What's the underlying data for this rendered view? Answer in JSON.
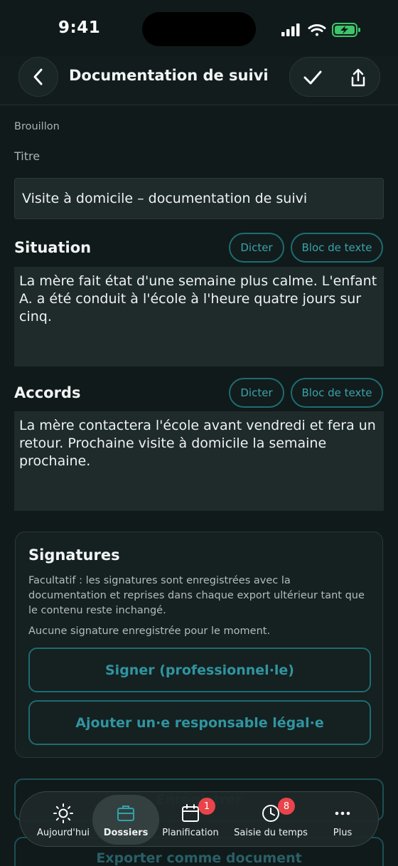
{
  "status_bar": {
    "time": "9:41"
  },
  "header": {
    "title": "Documentation de suivi"
  },
  "form": {
    "status": "Brouillon",
    "title_label": "Titre",
    "title_value": "Visite à domicile – documentation de suivi",
    "situation": {
      "heading": "Situation",
      "dictate_label": "Dicter",
      "text_block_label": "Bloc de texte",
      "text": "La mère fait état d'une semaine plus calme. L'enfant A. a été conduit à l'école à l'heure quatre jours sur cinq."
    },
    "agreements": {
      "heading": "Accords",
      "dictate_label": "Dicter",
      "text_block_label": "Bloc de texte",
      "text": "La mère contactera l'école avant vendredi et fera un retour. Prochaine visite à domicile la semaine prochaine."
    }
  },
  "signatures": {
    "title": "Signatures",
    "description": "Facultatif : les signatures sont enregistrées avec la documentation et reprises dans chaque export ultérieur tant que le contenu reste inchangé.",
    "none_text": "Aucune signature enregistrée pour le moment.",
    "sign_button": "Signer (professionnel·le)",
    "add_guardian_button": "Ajouter un·e responsable légal·e"
  },
  "actions": {
    "save_label": "Enregistrer",
    "export_label": "Exporter comme document"
  },
  "tabbar": {
    "tabs": [
      {
        "label": "Aujourd'hui",
        "icon": "sun-icon"
      },
      {
        "label": "Dossiers",
        "icon": "briefcase-icon",
        "active": true
      },
      {
        "label": "Planification",
        "icon": "calendar-icon",
        "badge": "1"
      },
      {
        "label": "Saisie du temps",
        "icon": "clock-icon",
        "badge": "8"
      },
      {
        "label": "Plus",
        "icon": "more-icon"
      }
    ]
  },
  "colors": {
    "accent": "#1d6c73",
    "accent_text": "#3aa2ab",
    "background": "#101a1a",
    "badge": "#e8444a"
  }
}
